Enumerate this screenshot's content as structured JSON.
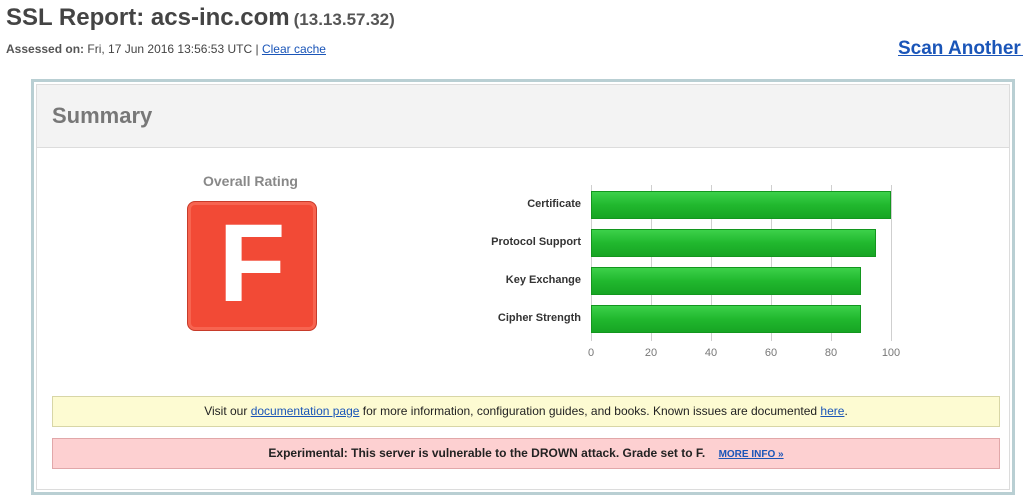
{
  "header": {
    "title": "SSL Report: acs-inc.com",
    "ip": "(13.13.57.32)",
    "assessed_label": "Assessed on:",
    "assessed_value": "Fri, 17 Jun 2016 13:56:53 UTC",
    "separator": "|",
    "clear_cache": "Clear cache",
    "scan_another": "Scan Another »"
  },
  "summary": {
    "title": "Summary",
    "overall_rating_label": "Overall Rating",
    "grade": "F",
    "grade_color": "#f24a36"
  },
  "chart_data": {
    "type": "bar",
    "orientation": "horizontal",
    "categories": [
      "Certificate",
      "Protocol Support",
      "Key Exchange",
      "Cipher Strength"
    ],
    "values": [
      100,
      95,
      90,
      90
    ],
    "xlim": [
      0,
      100
    ],
    "ticks": [
      0,
      20,
      40,
      60,
      80,
      100
    ],
    "bar_color": "#21b82e"
  },
  "notices": {
    "docs": {
      "pre": "Visit our",
      "link1": "documentation page",
      "mid": "for more information, configuration guides, and books. Known issues are documented",
      "link2": "here",
      "post": "."
    },
    "drown": {
      "text": "Experimental: This server is vulnerable to the DROWN attack. Grade set to F.",
      "more": "MORE INFO »"
    }
  }
}
